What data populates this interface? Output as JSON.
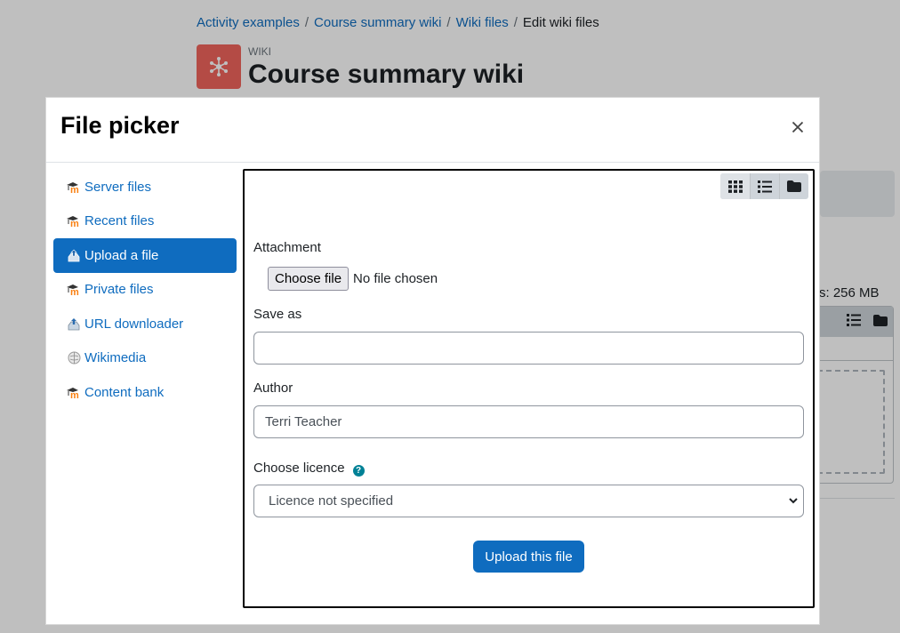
{
  "breadcrumb": {
    "items": [
      "Activity examples",
      "Course summary wiki",
      "Wiki files"
    ],
    "current": "Edit wiki files",
    "separator": "/"
  },
  "activity": {
    "type": "WIKI",
    "title": "Course summary wiki",
    "icon": "wiki-icon",
    "icon_color": "#f0655c"
  },
  "background": {
    "max_size_text": "iles: 256 MB"
  },
  "file_picker": {
    "title": "File picker",
    "close_icon": "close-icon",
    "repositories": [
      {
        "label": "Server files",
        "icon": "moodle-icon",
        "active": false
      },
      {
        "label": "Recent files",
        "icon": "moodle-icon",
        "active": false
      },
      {
        "label": "Upload a file",
        "icon": "upload-icon",
        "active": true
      },
      {
        "label": "Private files",
        "icon": "moodle-icon",
        "active": false
      },
      {
        "label": "URL downloader",
        "icon": "url-downloader-icon",
        "active": false
      },
      {
        "label": "Wikimedia",
        "icon": "wikimedia-icon",
        "active": false
      },
      {
        "label": "Content bank",
        "icon": "moodle-icon",
        "active": false
      }
    ],
    "view_modes": [
      "grid-icon",
      "list-icon",
      "folder-icon"
    ],
    "form": {
      "attachment_label": "Attachment",
      "choose_file_label": "Choose file",
      "no_file_text": "No file chosen",
      "save_as_label": "Save as",
      "save_as_value": "",
      "author_label": "Author",
      "author_value": "Terri Teacher",
      "licence_label": "Choose licence",
      "help_icon": "question-circle-icon",
      "licence_selected": "Licence not specified",
      "upload_button": "Upload this file"
    }
  },
  "colors": {
    "primary": "#0f6cbf",
    "link": "#0f6cbf",
    "help": "#008196",
    "text": "#1d2125"
  }
}
